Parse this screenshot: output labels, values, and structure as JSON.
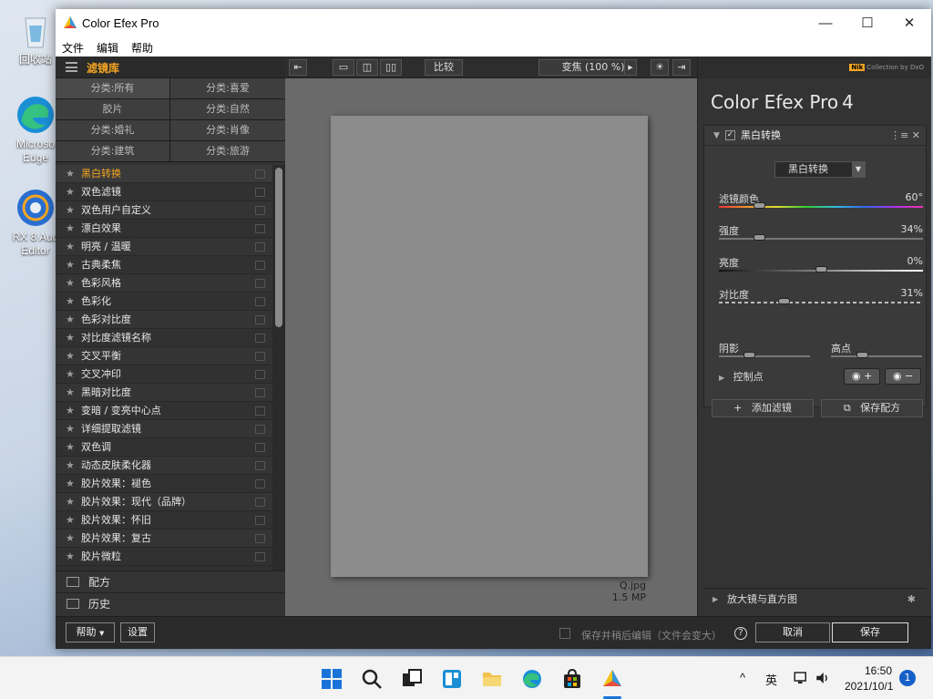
{
  "desktop": {
    "icons": [
      {
        "label": "回收站"
      },
      {
        "label": "Microsoft Edge",
        "line1": "Microso",
        "line2": "Edge"
      },
      {
        "label": "RX 8 Audio Editor",
        "line1": "RX 8 Aud",
        "line2": "Editor"
      }
    ]
  },
  "window": {
    "title": "Color Efex Pro",
    "controls": {
      "minimize": "—",
      "maximize": "☐",
      "close": "✕"
    },
    "menu": [
      "文件",
      "编辑",
      "帮助"
    ]
  },
  "library": {
    "title": "滤镜库",
    "categories": [
      "分类:所有",
      "分类:喜爱",
      "胶片",
      "分类:自然",
      "分类:婚礼",
      "分类:肖像",
      "分类:建筑",
      "分类:旅游"
    ],
    "filters": [
      "黑白转换",
      "双色滤镜",
      "双色用户自定义",
      "漂白效果",
      "明亮 / 温暖",
      "古典柔焦",
      "色彩风格",
      "色彩化",
      "色彩对比度",
      "对比度滤镜名称",
      "交叉平衡",
      "交叉冲印",
      "黑暗对比度",
      "变暗 / 变亮中心点",
      "详细提取滤镜",
      "双色调",
      "动态皮肤柔化器",
      "胶片效果：褪色",
      "胶片效果：现代（品牌）",
      "胶片效果：怀旧",
      "胶片效果：复古",
      "胶片微粒"
    ],
    "selected": "黑白转换",
    "sections": [
      "配方",
      "历史"
    ]
  },
  "toolbar": {
    "compare": "比较",
    "zoom": "变焦 (100 %)"
  },
  "preview": {
    "filename": "Q.jpg",
    "size": "1.5 MP"
  },
  "panel": {
    "brand": "Color Efex Pro",
    "version": "4",
    "nik_badge": "Nik",
    "nik_text": "Collection by DxO",
    "filter_name": "黑白转换",
    "mode_select": "黑白转换",
    "sliders": {
      "color_filter": {
        "label": "滤镜颜色",
        "value": "60°",
        "level": 0.18
      },
      "strength": {
        "label": "强度",
        "value": "34%",
        "level": 0.18
      },
      "brightness": {
        "label": "亮度",
        "value": "0%",
        "level": 0.5
      },
      "contrast": {
        "label": "对比度",
        "value": "31%",
        "level": 0.31
      },
      "shadows": {
        "label": "阴影"
      },
      "highlights": {
        "label": "高点"
      }
    },
    "control_points": "控制点",
    "add_filter": "添加滤镜",
    "save_recipe": "保存配方",
    "loupe": "放大镜与直方图"
  },
  "bottom": {
    "help": "帮助",
    "settings": "设置",
    "save_later": "保存并稍后编辑（文件会变大）",
    "cancel": "取消",
    "save": "保存"
  },
  "taskbar": {
    "ime": "英",
    "time": "16:50",
    "date": "2021/10/1",
    "notifications": "1"
  }
}
